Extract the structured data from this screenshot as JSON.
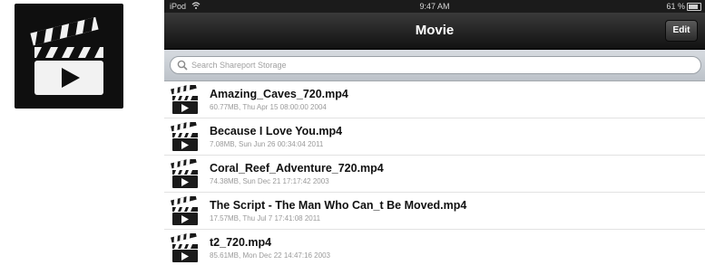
{
  "app_icon": {
    "icon": "clapperboard-play-icon"
  },
  "status_bar": {
    "carrier": "iPod",
    "time": "9:47 AM",
    "battery": "61 %"
  },
  "nav": {
    "title": "Movie",
    "edit_label": "Edit"
  },
  "search": {
    "placeholder": "Search Shareport Storage"
  },
  "files": [
    {
      "name": "Amazing_Caves_720.mp4",
      "meta": "60.77MB, Thu Apr 15 08:00:00 2004"
    },
    {
      "name": "Because I Love You.mp4",
      "meta": "7.08MB, Sun Jun 26 00:34:04 2011"
    },
    {
      "name": "Coral_Reef_Adventure_720.mp4",
      "meta": "74.38MB, Sun Dec 21 17:17:42 2003"
    },
    {
      "name": "The Script - The Man Who Can_t Be Moved.mp4",
      "meta": "17.57MB, Thu Jul 7 17:41:08 2011"
    },
    {
      "name": "t2_720.mp4",
      "meta": "85.61MB, Mon Dec 22 14:47:16 2003"
    }
  ]
}
